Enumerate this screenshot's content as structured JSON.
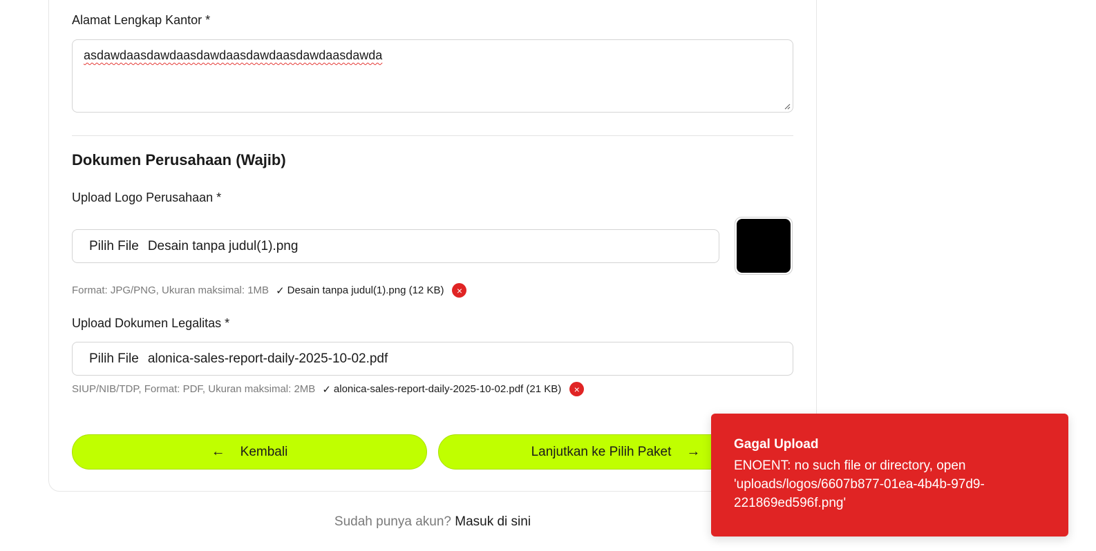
{
  "address": {
    "label": "Alamat Lengkap Kantor *",
    "value": "asdawdaasdawdaasdawdaasdawdaasdawdaasdawda"
  },
  "documents": {
    "section_title": "Dokumen Perusahaan (Wajib)",
    "logo": {
      "label": "Upload Logo Perusahaan *",
      "choose_button": "Pilih File",
      "file_name": "Desain tanpa judul(1).png",
      "hint": "Format: JPG/PNG, Ukuran maksimal: 1MB",
      "check": "✓",
      "uploaded": "Desain tanpa judul(1).png (12 KB)",
      "preview_color": "#000000"
    },
    "legal": {
      "label": "Upload Dokumen Legalitas *",
      "choose_button": "Pilih File",
      "file_name": "alonica-sales-report-daily-2025-10-02.pdf",
      "hint": "SIUP/NIB/TDP, Format: PDF, Ukuran maksimal: 2MB",
      "check": "✓",
      "uploaded": "alonica-sales-report-daily-2025-10-02.pdf (21 KB)"
    },
    "remove_icon": "×"
  },
  "actions": {
    "back_label": "Kembali",
    "back_icon": "←",
    "next_label": "Lanjutkan ke Pilih Paket",
    "next_icon": "→",
    "accent_color": "#c0ff00"
  },
  "login": {
    "prompt": "Sudah punya akun?",
    "link": "Masuk di sini"
  },
  "toast": {
    "title": "Gagal Upload",
    "message": "ENOENT: no such file or directory, open 'uploads/logos/6607b877-01ea-4b4b-97d9-221869ed596f.png'",
    "color": "#e02424"
  }
}
